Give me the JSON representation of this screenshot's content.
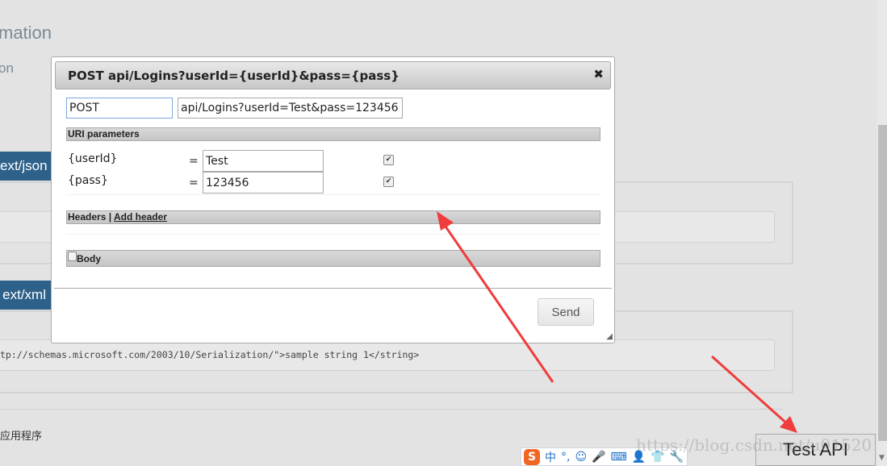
{
  "background": {
    "heading": "mation",
    "subheading": "on",
    "tab_json": "ext/json",
    "tab_xml": "ext/xml",
    "xml_sample": "tp://schemas.microsoft.com/2003/10/Serialization/\">sample string 1</string>",
    "footer_text": "应用程序"
  },
  "dialog": {
    "title": "POST api/Logins?userId={userId}&pass={pass}",
    "close_icon": "✖",
    "method": "POST",
    "url": "api/Logins?userId=Test&pass=123456",
    "uri_parameters_label": "URI parameters",
    "params": [
      {
        "name": "{userId}",
        "eq": "=",
        "value": "Test",
        "checked": true
      },
      {
        "name": "{pass}",
        "eq": "=",
        "value": "123456",
        "checked": true
      }
    ],
    "headers_label": "Headers",
    "separator": "|",
    "add_header_label": "Add header",
    "body_label": "Body",
    "send_label": "Send"
  },
  "test_api_label": "Test API",
  "ime": {
    "logo": "S",
    "items": [
      "中",
      "°,",
      "☺",
      "🎤",
      "⌨",
      "👤",
      "👕",
      "🔧"
    ]
  },
  "watermark": "https://blog.csdn.net/u01520",
  "colors": {
    "accent_tab": "#2e6189",
    "arrow": "#f03c3c",
    "ime": "#1e6fc8"
  }
}
